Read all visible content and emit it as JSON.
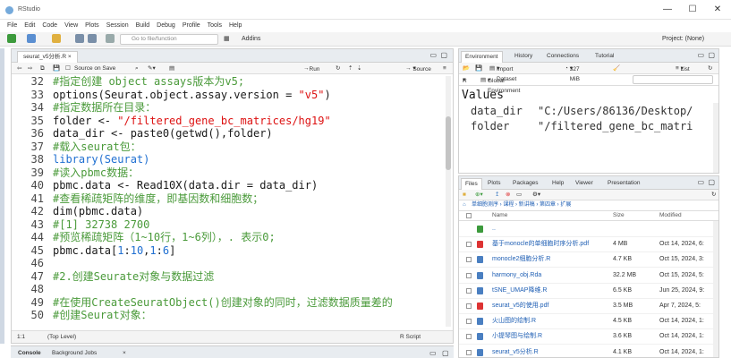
{
  "window": {
    "title": "RStudio",
    "minimize": "—",
    "maximize": "☐",
    "close": "✕"
  },
  "menu": [
    "File",
    "Edit",
    "Code",
    "View",
    "Plots",
    "Session",
    "Build",
    "Debug",
    "Profile",
    "Tools",
    "Help"
  ],
  "toolbar": {
    "goto_placeholder": "Go to file/function",
    "addins": "Addins",
    "project": "Project: (None)"
  },
  "source": {
    "tab": "seurat_v5分析.R",
    "source_on_save": "Source on Save",
    "run": "Run",
    "source": "Source",
    "status_pos": "1:1",
    "status_level": "(Top Level)",
    "status_type": "R Script",
    "lines": [
      {
        "n": "32",
        "parts": [
          {
            "t": "#指定创建 object assays版本为v5;",
            "c": "cmt"
          }
        ]
      },
      {
        "n": "33",
        "parts": [
          {
            "t": "options(Seurat.object.assay.version = ",
            "c": "plain"
          },
          {
            "t": "\"v5\"",
            "c": "str"
          },
          {
            "t": ")",
            "c": "plain"
          }
        ]
      },
      {
        "n": "34",
        "parts": [
          {
            "t": "#指定数据所在目录：",
            "c": "cmt"
          }
        ]
      },
      {
        "n": "35",
        "parts": [
          {
            "t": "folder <- ",
            "c": "plain"
          },
          {
            "t": "\"/filtered_gene_bc_matrices/hg19\"",
            "c": "str"
          }
        ]
      },
      {
        "n": "36",
        "parts": [
          {
            "t": "data_dir <- paste0(getwd(),folder)",
            "c": "plain"
          }
        ]
      },
      {
        "n": "37",
        "parts": [
          {
            "t": "#载入seurat包：",
            "c": "cmt"
          }
        ]
      },
      {
        "n": "38",
        "parts": [
          {
            "t": "library(Seurat)",
            "c": "kw"
          }
        ]
      },
      {
        "n": "39",
        "parts": [
          {
            "t": "#读入pbmc数据：",
            "c": "cmt"
          }
        ]
      },
      {
        "n": "40",
        "parts": [
          {
            "t": "pbmc.data <- Read10X(data.dir = data_dir)",
            "c": "plain"
          }
        ]
      },
      {
        "n": "41",
        "parts": [
          {
            "t": "#查看稀疏矩阵的维度，即基因数和细胞数；",
            "c": "cmt"
          }
        ]
      },
      {
        "n": "42",
        "parts": [
          {
            "t": "dim(pbmc.data)",
            "c": "plain"
          }
        ]
      },
      {
        "n": "43",
        "parts": [
          {
            "t": "#[1] 32738 2700",
            "c": "cmt"
          }
        ]
      },
      {
        "n": "44",
        "parts": [
          {
            "t": "#预览稀疏矩阵（1~10行，1~6列），. 表示0;",
            "c": "cmt"
          }
        ]
      },
      {
        "n": "45",
        "parts": [
          {
            "t": "pbmc.data[",
            "c": "plain"
          },
          {
            "t": "1",
            "c": "num"
          },
          {
            "t": ":",
            "c": "plain"
          },
          {
            "t": "10",
            "c": "num"
          },
          {
            "t": ",",
            "c": "plain"
          },
          {
            "t": "1",
            "c": "num"
          },
          {
            "t": ":",
            "c": "plain"
          },
          {
            "t": "6",
            "c": "num"
          },
          {
            "t": "]",
            "c": "plain"
          }
        ]
      },
      {
        "n": "46",
        "parts": [
          {
            "t": "",
            "c": "plain"
          }
        ]
      },
      {
        "n": "47",
        "parts": [
          {
            "t": "#2.创建Seurate对象与数据过滤",
            "c": "cmt"
          }
        ]
      },
      {
        "n": "48",
        "parts": [
          {
            "t": "",
            "c": "plain"
          }
        ]
      },
      {
        "n": "49",
        "parts": [
          {
            "t": "#在使用CreateSeuratObject()创建对象的同时，过滤数据质量差的",
            "c": "cmt"
          }
        ]
      },
      {
        "n": "50",
        "parts": [
          {
            "t": "#创建Seurat对象：",
            "c": "cmt"
          }
        ]
      }
    ]
  },
  "console": {
    "tab1": "Console",
    "tab2": "Background Jobs"
  },
  "env": {
    "tabs": [
      "Environment",
      "History",
      "Connections",
      "Tutorial"
    ],
    "import": "Import Dataset",
    "mem": "327 MiB",
    "list": "List",
    "lang": "R",
    "scope": "Global Environment",
    "header": "Values",
    "rows": [
      {
        "name": "data_dir",
        "value": "\"C:/Users/86136/Desktop/"
      },
      {
        "name": "folder",
        "value": "\"/filtered_gene_bc_matri"
      }
    ]
  },
  "files": {
    "tabs": [
      "Files",
      "Plots",
      "Packages",
      "Help",
      "Viewer",
      "Presentation"
    ],
    "breadcrumb": "单细胞测序 › 课程 › 新讲稿 › 第四章 › 扩展",
    "col_name": "Name",
    "col_size": "Size",
    "col_modified": "Modified",
    "rows": [
      {
        "name": "..",
        "size": "",
        "date": "",
        "color": "#3c9a3c"
      },
      {
        "name": "基于monocle的单细胞时序分析.pdf",
        "size": "4 MB",
        "date": "Oct 14, 2024, 6:",
        "color": "#d33"
      },
      {
        "name": "monocle2细胞分析.R",
        "size": "4.7 KB",
        "date": "Oct 15, 2024, 3:",
        "color": "#4a7fc1"
      },
      {
        "name": "harmony_obj.Rda",
        "size": "32.2 MB",
        "date": "Oct 15, 2024, 5:",
        "color": "#4a7fc1"
      },
      {
        "name": "tSNE_UMAP降维.R",
        "size": "6.5 KB",
        "date": "Jun 25, 2024, 9:",
        "color": "#4a7fc1"
      },
      {
        "name": "seurat_v5的使用.pdf",
        "size": "3.5 MB",
        "date": "Apr 7, 2024, 5:",
        "color": "#d33"
      },
      {
        "name": "火山图的绘制.R",
        "size": "4.5 KB",
        "date": "Oct 14, 2024, 1:",
        "color": "#4a7fc1"
      },
      {
        "name": "小提琴图与绘制.R",
        "size": "3.6 KB",
        "date": "Oct 14, 2024, 1:",
        "color": "#4a7fc1"
      },
      {
        "name": "seurat_v5分析.R",
        "size": "4.1 KB",
        "date": "Oct 14, 2024, 1:",
        "color": "#4a7fc1"
      }
    ]
  }
}
